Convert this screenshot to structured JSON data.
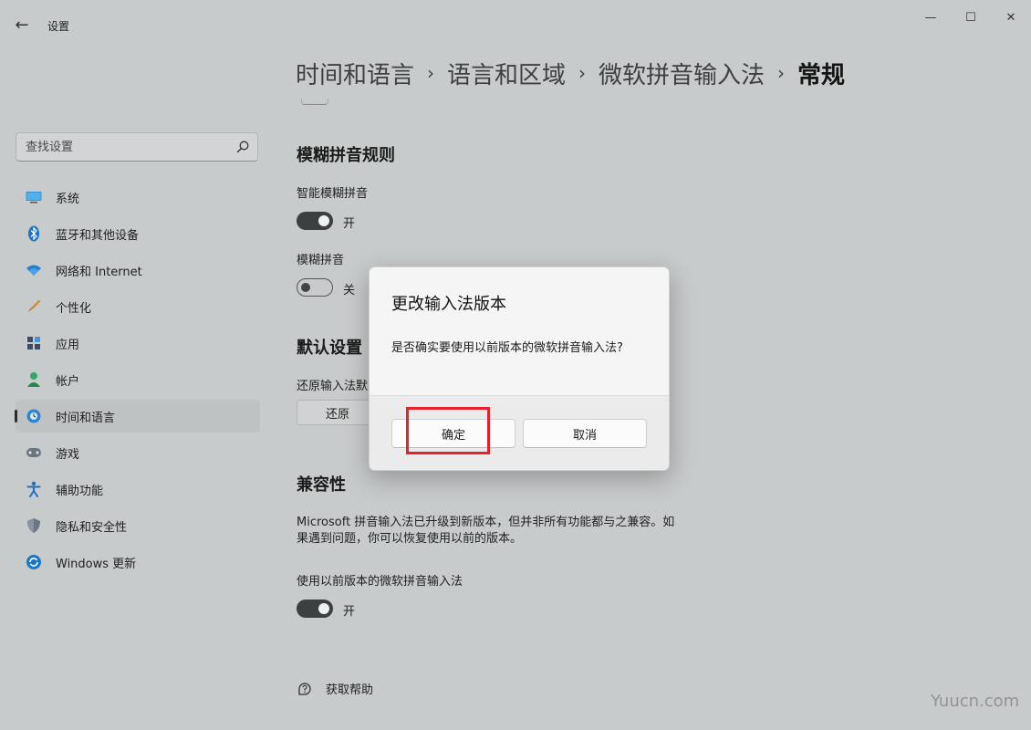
{
  "window": {
    "app_title": "设置",
    "back_icon": "←",
    "controls": {
      "minimize": "—",
      "maximize": "☐",
      "close": "✕"
    }
  },
  "breadcrumb": [
    {
      "label": "时间和语言"
    },
    {
      "label": "语言和区域"
    },
    {
      "label": "微软拼音输入法"
    },
    {
      "label": "常规"
    }
  ],
  "breadcrumb_separator": "›",
  "search": {
    "placeholder": "查找设置"
  },
  "sidebar": {
    "items": [
      {
        "label": "系统",
        "icon": "monitor-icon"
      },
      {
        "label": "蓝牙和其他设备",
        "icon": "bluetooth-icon"
      },
      {
        "label": "网络和 Internet",
        "icon": "wifi-icon"
      },
      {
        "label": "个性化",
        "icon": "brush-icon"
      },
      {
        "label": "应用",
        "icon": "apps-icon"
      },
      {
        "label": "帐户",
        "icon": "person-icon"
      },
      {
        "label": "时间和语言",
        "icon": "globe-clock-icon",
        "active": true
      },
      {
        "label": "游戏",
        "icon": "gamepad-icon"
      },
      {
        "label": "辅助功能",
        "icon": "accessibility-icon"
      },
      {
        "label": "隐私和安全性",
        "icon": "shield-icon"
      },
      {
        "label": "Windows 更新",
        "icon": "update-icon"
      }
    ]
  },
  "content": {
    "fuzzy": {
      "title": "模糊拼音规则",
      "smart_label": "智能模糊拼音",
      "smart_state": "开",
      "smart_on": true,
      "fuzzy_label": "模糊拼音",
      "fuzzy_state": "关",
      "fuzzy_on": false
    },
    "defaults": {
      "title": "默认设置",
      "restore_label": "还原输入法默",
      "restore_button": "还原"
    },
    "compat": {
      "title": "兼容性",
      "desc_line1": "Microsoft 拼音输入法已升级到新版本，但并非所有功能都与之兼容。如",
      "desc_line2": "果遇到问题，你可以恢复使用以前的版本。",
      "prev_label": "使用以前版本的微软拼音输入法",
      "prev_state": "开",
      "prev_on": true
    },
    "help": {
      "label": "获取帮助",
      "icon": "help-icon"
    }
  },
  "dialog": {
    "title": "更改输入法版本",
    "message": "是否确实要使用以前版本的微软拼音输入法?",
    "confirm": "确定",
    "cancel": "取消"
  },
  "colors": {
    "background": "#c8cbcc",
    "dialog": "#f5f5f5",
    "toggle_on": "#3b4143",
    "highlight": "#e8202a"
  },
  "watermark": "Yuucn.com"
}
